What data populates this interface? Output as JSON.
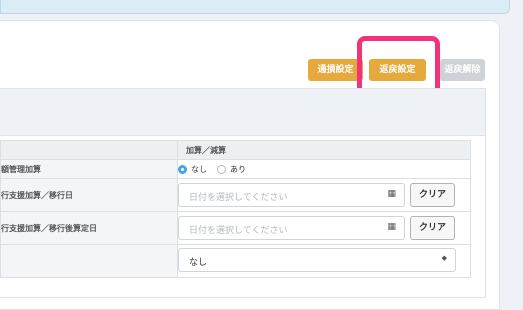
{
  "toolbar": {
    "buttons": [
      {
        "label": "通損設定"
      },
      {
        "label": "返戻設定"
      },
      {
        "label": "返戻解除"
      }
    ],
    "colors": {
      "accent": "#e5a93c",
      "disabled": "#cfd2d6",
      "highlight": "#f0337b"
    }
  },
  "table": {
    "header_value": "加算／減算",
    "rows": [
      {
        "label": "額管理加算",
        "radio_options": [
          "なし",
          "あり"
        ],
        "selected": "なし"
      },
      {
        "label": "行支援加算／移行日",
        "placeholder": "日付を選択してください",
        "clear_label": "クリア"
      },
      {
        "label": "行支援加算／移行後算定日",
        "placeholder": "日付を選択してください",
        "clear_label": "クリア"
      },
      {
        "label": "",
        "select_value": "なし"
      }
    ]
  }
}
